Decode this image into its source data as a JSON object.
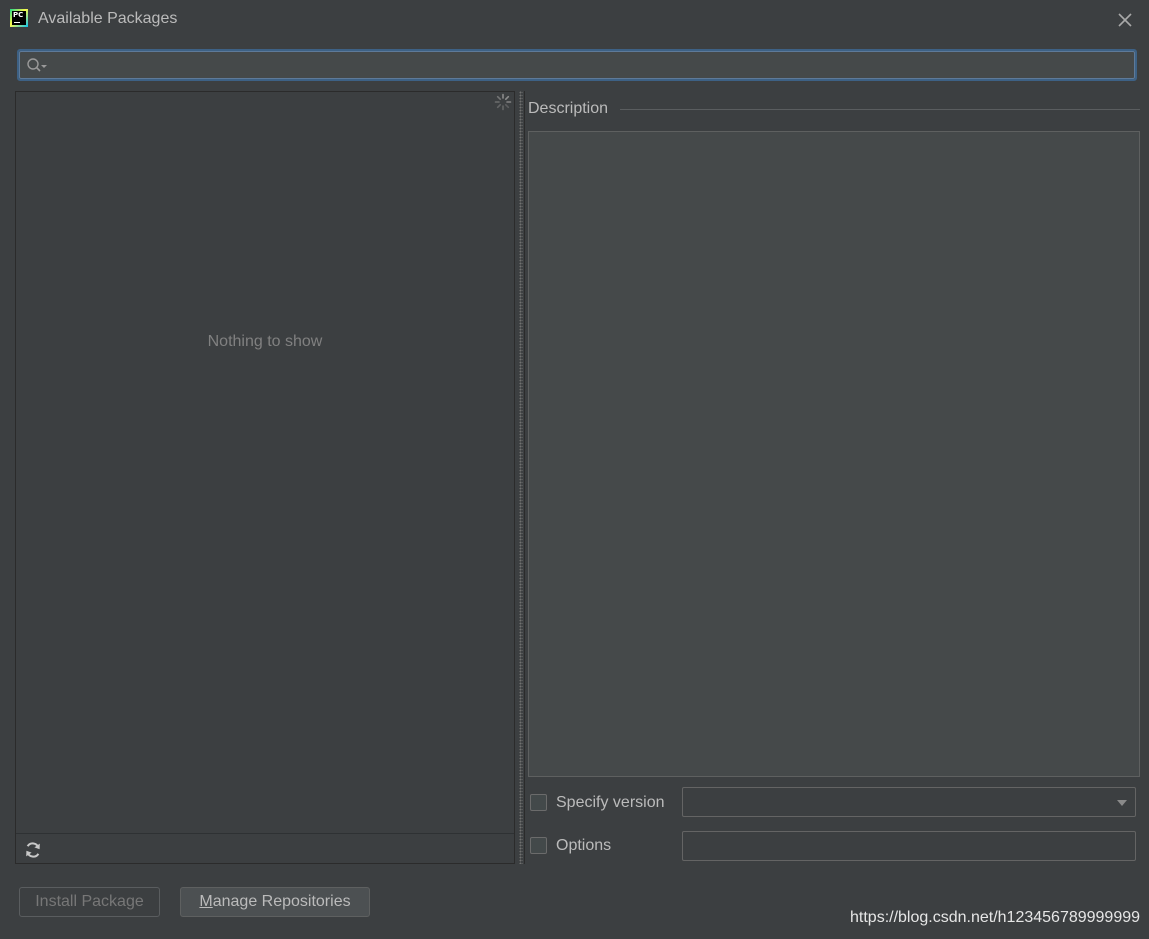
{
  "window": {
    "title": "Available Packages",
    "app_icon": "pycharm-logo",
    "app_icon_text": "PC"
  },
  "search": {
    "value": "",
    "placeholder": "",
    "icon": "search-icon"
  },
  "package_list": {
    "empty_text": "Nothing to show",
    "loading_icon": "spinner-icon",
    "toolbar": {
      "refresh_icon": "refresh-icon"
    }
  },
  "description": {
    "title": "Description",
    "content": ""
  },
  "options": {
    "specify_version_label": "Specify version",
    "specify_version_checked": false,
    "version_value": "",
    "options_label": "Options",
    "options_checked": false,
    "options_value": ""
  },
  "buttons": {
    "install_label": "Install Package",
    "install_enabled": false,
    "manage_mnemonic": "M",
    "manage_rest": "anage Repositories"
  },
  "watermark": "https://blog.csdn.net/h123456789999999",
  "colors": {
    "background": "#3c3f41",
    "field_background": "#45494a",
    "focus_border": "#3d6185",
    "text": "#bbbbbb",
    "muted_text": "#808080"
  }
}
